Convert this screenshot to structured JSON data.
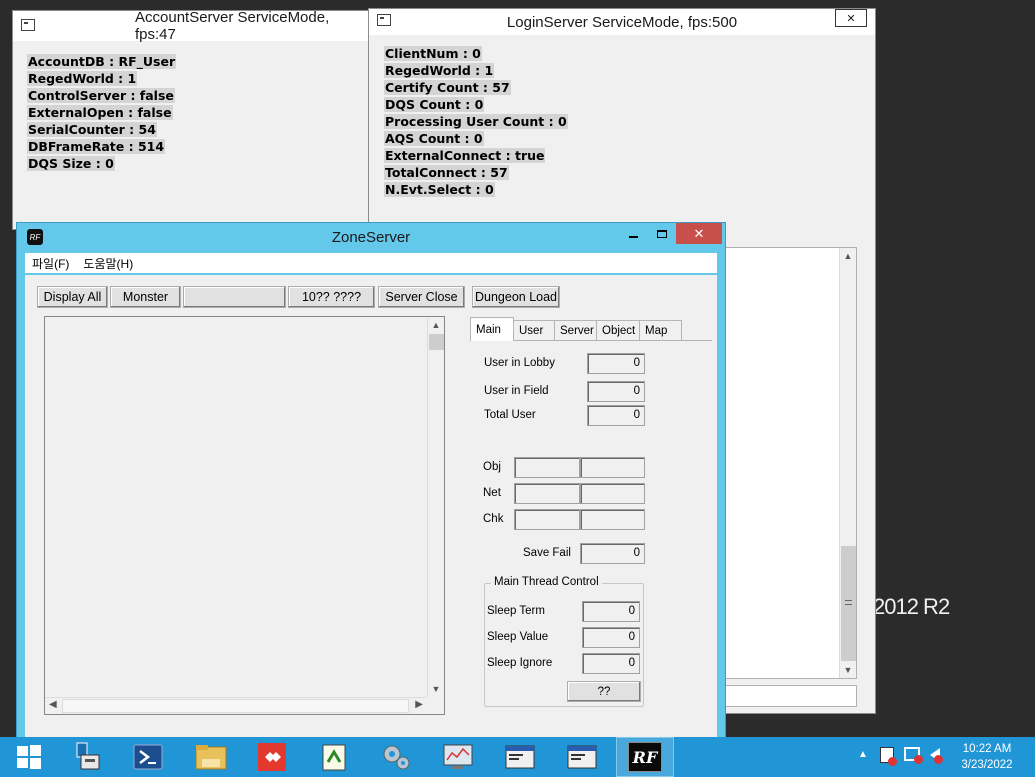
{
  "desktop": {
    "watermark": "2012 R2"
  },
  "account_window": {
    "title": "AccountServer ServiceMode, fps:47",
    "lines": [
      "AccountDB : RF_User",
      "RegedWorld : 1",
      "ControlServer : false",
      "ExternalOpen : false",
      "SerialCounter : 54",
      "DBFrameRate : 514",
      "DQS Size : 0"
    ]
  },
  "login_window": {
    "title": "LoginServer ServiceMode, fps:500",
    "close_glyph": "✕",
    "lines": [
      "ClientNum : 0",
      "RegedWorld : 1",
      "Certify Count : 57",
      "DQS Count : 0",
      "Processing User Count : 0",
      "AQS Count : 0",
      "ExternalConnect : true",
      "TotalConnect : 57",
      "N.Evt.Select : 0"
    ]
  },
  "zone_window": {
    "title": "ZoneServer",
    "app_icon": "RF",
    "menu": [
      "파일(F)",
      "도움말(H)"
    ],
    "toolbar": {
      "display_all": "Display All",
      "monster": "Monster",
      "blank": "",
      "lang": "10?? ????",
      "server_close": "Server Close",
      "dungeon_load": "Dungeon Load"
    },
    "tabs": [
      "Main",
      "User",
      "Server",
      "Object",
      "Map"
    ],
    "main_tab": {
      "user_in_lobby": {
        "label": "User in Lobby",
        "value": "0"
      },
      "user_in_field": {
        "label": "User in Field",
        "value": "0"
      },
      "total_user": {
        "label": "Total User",
        "value": "0"
      },
      "obj": {
        "label": "Obj",
        "v1": "",
        "v2": ""
      },
      "net": {
        "label": "Net",
        "v1": "",
        "v2": ""
      },
      "chk": {
        "label": "Chk",
        "v1": "",
        "v2": ""
      },
      "save_fail": {
        "label": "Save Fail",
        "value": "0"
      },
      "thread_group": {
        "caption": "Main Thread Control",
        "sleep_term": {
          "label": "Sleep Term",
          "value": "0"
        },
        "sleep_value": {
          "label": "Sleep Value",
          "value": "0"
        },
        "sleep_ignore": {
          "label": "Sleep Ignore",
          "value": "0"
        },
        "apply_button": "??"
      }
    }
  },
  "taskbar": {
    "clock_time": "10:22 AM",
    "clock_date": "3/23/2022",
    "rf_label": "RF"
  }
}
